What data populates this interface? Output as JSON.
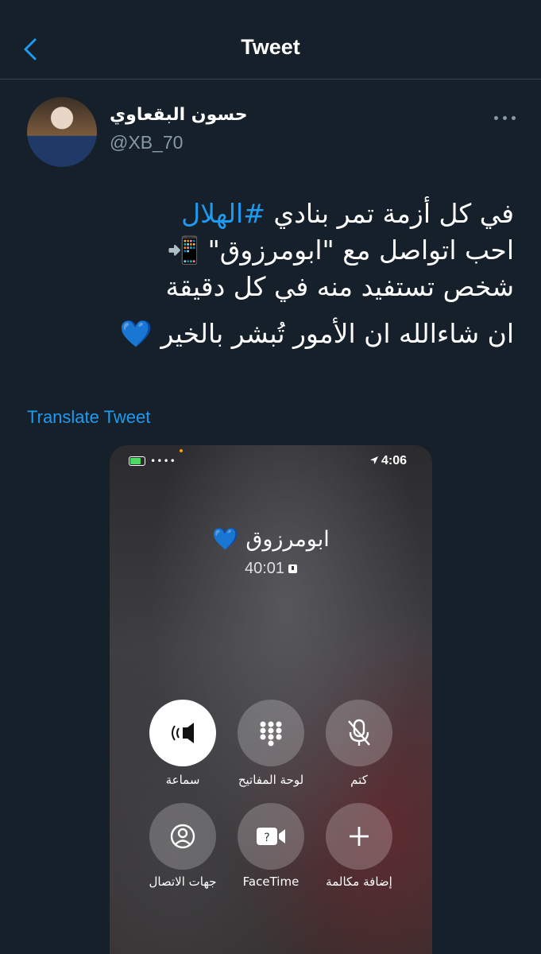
{
  "header": {
    "title": "Tweet"
  },
  "author": {
    "name": "حسون البقعاوي",
    "handle": "@XB_70"
  },
  "tweet": {
    "lines": [
      "في كل أزمة تمر بنادي ",
      "#الهلال",
      "احب اتواصل مع \"ابومرزوق\" 📲",
      "شخص تستفيد منه في كل دقيقة",
      "ان شاءالله ان الأمور تُبشر بالخير 💙"
    ]
  },
  "translate_label": "Translate Tweet",
  "phone": {
    "status_time": "4:06",
    "caller_name": "ابومرزوق 💙",
    "call_duration": "40:01",
    "buttons": [
      {
        "label": "سماعة",
        "icon": "speaker-icon",
        "active": true
      },
      {
        "label": "لوحة المفاتيح",
        "icon": "keypad-icon",
        "active": false
      },
      {
        "label": "كتم",
        "icon": "mute-icon",
        "active": false
      },
      {
        "label": "جهات الاتصال",
        "icon": "contacts-icon",
        "active": false
      },
      {
        "label": "FaceTime",
        "icon": "facetime-icon",
        "active": false
      },
      {
        "label": "إضافة مكالمة",
        "icon": "add-call-icon",
        "active": false
      }
    ]
  },
  "colors": {
    "background": "#15202b",
    "accent": "#1d9bf0",
    "muted": "#8899a6"
  }
}
